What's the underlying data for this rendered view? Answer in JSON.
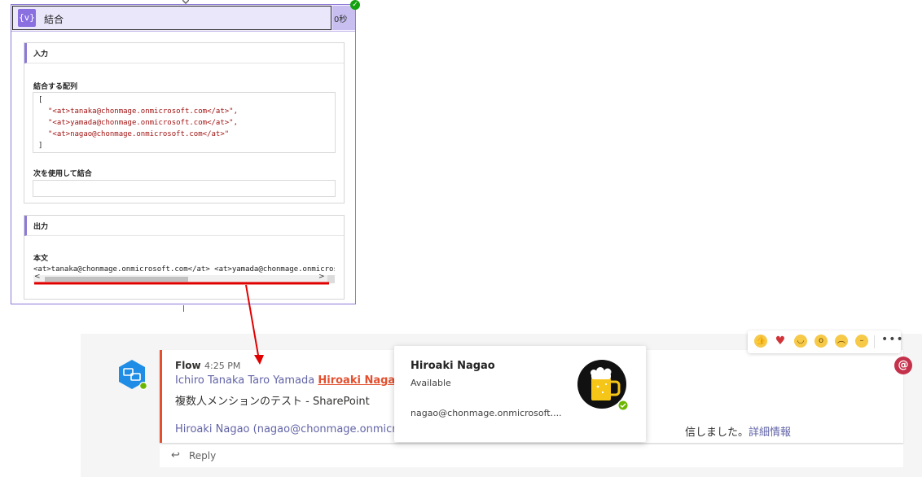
{
  "flow": {
    "step_title": "結合",
    "duration": "0秒",
    "input_section_title": "入力",
    "array_label": "結合する配列",
    "array_open": "[",
    "array_items": [
      "\"<at>tanaka@chonmage.onmicrosoft.com</at>\",",
      "\"<at>yamada@chonmage.onmicrosoft.com</at>\",",
      "\"<at>nagao@chonmage.onmicrosoft.com</at>\""
    ],
    "array_close": "]",
    "join_label": "次を使用して結合",
    "join_value": "",
    "output_section_title": "出力",
    "body_label": "本文",
    "body_value": "<at>tanaka@chonmage.onmicrosoft.com</at> <at>yamada@chonmage.onmicrosoft.com</at>"
  },
  "teams": {
    "sender": "Flow",
    "time": "4:25 PM",
    "mention_1": "Ichiro Tanaka",
    "mention_2": "Taro Yamada",
    "mention_3": "Hiroaki Nagao",
    "message": "複数人メンションのテスト - SharePoint",
    "footer_text": "Hiroaki Nagao (nagao@chonmage.onmicros",
    "footer_tail": "信しました。",
    "footer_link": "詳細情報",
    "reply_label": "Reply",
    "more_label": "•••",
    "mention_badge": "@"
  },
  "profile": {
    "name": "Hiroaki Nagao",
    "status": "Available",
    "email": "nagao@chonmage.onmicrosoft...."
  },
  "colors": {
    "flow_accent": "#8e7ad6",
    "mention_red": "#e2502f",
    "teams_purple": "#6264a7",
    "available_green": "#13a10e",
    "annotation_red": "#e00000"
  },
  "icons": {
    "variable": "variable-icon",
    "check": "check-icon",
    "reply": "reply-icon",
    "more": "more-options-icon"
  }
}
